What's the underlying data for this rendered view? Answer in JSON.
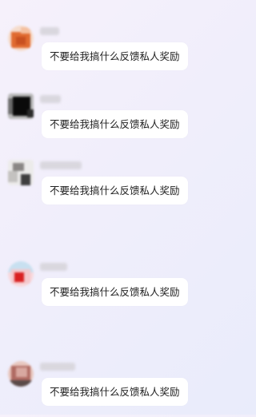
{
  "messages": [
    {
      "sender": "",
      "text": "不要给我搞什么反馈私人奖励",
      "avatar_palette": [
        "#e06a30",
        "#f4c0a0",
        "#c85020",
        "#f5dccc"
      ]
    },
    {
      "sender": "",
      "text": "不要给我搞什么反馈私人奖励",
      "avatar_palette": [
        "#0a0a0a",
        "#6c6c6c",
        "#b8b8b8",
        "#2a2a2a"
      ]
    },
    {
      "sender": "",
      "text": "不要给我搞什么反馈私人奖励",
      "avatar_palette": [
        "#8a8785",
        "#ecebea",
        "#3e3e3e",
        "#c4c2c0"
      ]
    },
    {
      "sender": "",
      "text": "不要给我搞什么反馈私人奖励",
      "avatar_palette": [
        "#d92020",
        "#f4c8cc",
        "#c8e0f0",
        "#f8d8dc"
      ]
    },
    {
      "sender": "",
      "text": "不要给我搞什么反馈私人奖励",
      "avatar_palette": [
        "#b06a62",
        "#d8a8a0",
        "#5a4a48",
        "#e8c8c0"
      ]
    }
  ]
}
